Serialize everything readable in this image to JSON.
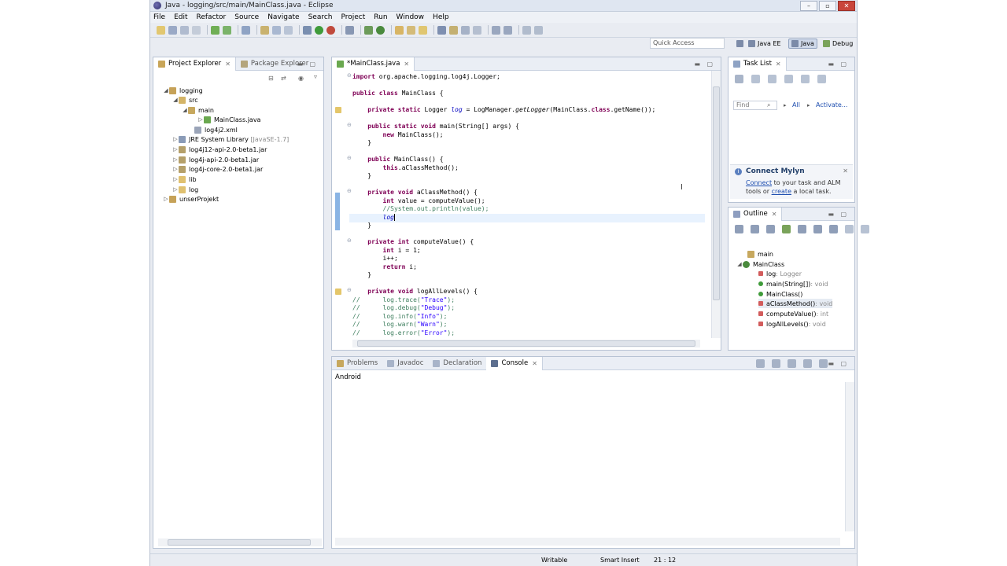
{
  "window": {
    "title": "Java - logging/src/main/MainClass.java - Eclipse",
    "controls": [
      "–",
      "▫",
      "✕"
    ]
  },
  "menu": [
    "File",
    "Edit",
    "Refactor",
    "Source",
    "Navigate",
    "Search",
    "Project",
    "Run",
    "Window",
    "Help"
  ],
  "quick_access": {
    "placeholder": "Quick Access"
  },
  "perspectives": [
    {
      "label": "Java EE"
    },
    {
      "label": "Java"
    },
    {
      "label": "Debug"
    }
  ],
  "project_explorer": {
    "tabs": [
      "Project Explorer",
      "Package Explorer"
    ],
    "tree": [
      {
        "label": "logging",
        "extra": ""
      },
      {
        "label": "src",
        "extra": ""
      },
      {
        "label": "main",
        "extra": ""
      },
      {
        "label": "MainClass.java",
        "extra": ""
      },
      {
        "label": "log4j2.xml",
        "extra": ""
      },
      {
        "label": "JRE System Library",
        "extra": "[JavaSE-1.7]"
      },
      {
        "label": "log4j12-api-2.0-beta1.jar",
        "extra": ""
      },
      {
        "label": "log4j-api-2.0-beta1.jar",
        "extra": ""
      },
      {
        "label": "log4j-core-2.0-beta1.jar",
        "extra": ""
      },
      {
        "label": "lib",
        "extra": ""
      },
      {
        "label": "log",
        "extra": ""
      },
      {
        "label": "unserProjekt",
        "extra": ""
      }
    ]
  },
  "editor": {
    "tab": "*MainClass.java",
    "lines": [
      "import org.apache.logging.log4j.Logger;",
      "",
      "public class MainClass {",
      "",
      "    private static Logger log = LogManager.getLogger(MainClass.class.getName());",
      "",
      "    public static void main(String[] args) {",
      "        new MainClass();",
      "    }",
      "",
      "    public MainClass() {",
      "        this.aClassMethod();",
      "    }",
      "",
      "    private void aClassMethod() {",
      "        int value = computeValue();",
      "        //System.out.println(value);",
      "        log",
      "    }",
      "",
      "    private int computeValue() {",
      "        int i = 1;",
      "        i++;",
      "        return i;",
      "    }",
      "",
      "    private void logAllLevels() {",
      "//      log.trace(\"Trace\");",
      "//      log.debug(\"Debug\");",
      "//      log.info(\"Info\");",
      "//      log.warn(\"Warn\");",
      "//      log.error(\"Error\");"
    ]
  },
  "task_list": {
    "tab": "Task List",
    "find_placeholder": "Find",
    "all_label": "All",
    "activate_label": "Activate..."
  },
  "mylyn": {
    "title": "Connect Mylyn",
    "link1": "Connect",
    "text1": " to your task and ALM",
    "text2": "tools or ",
    "link2": "create",
    "text3": " a local task."
  },
  "outline": {
    "tab": "Outline",
    "items": [
      {
        "label": "main",
        "type": ""
      },
      {
        "label": "MainClass",
        "type": ""
      },
      {
        "label": "log",
        "type": " : Logger"
      },
      {
        "label": "main(String[])",
        "type": " : void"
      },
      {
        "label": "MainClass()",
        "type": ""
      },
      {
        "label": "aClassMethod()",
        "type": " : void"
      },
      {
        "label": "computeValue()",
        "type": " : int"
      },
      {
        "label": "logAllLevels()",
        "type": " : void"
      }
    ]
  },
  "bottom": {
    "tabs": [
      "Problems",
      "Javadoc",
      "Declaration",
      "Console"
    ],
    "console_label": "Android"
  },
  "status": {
    "writable": "Writable",
    "insert_mode": "Smart Insert",
    "position": "21 : 12"
  }
}
